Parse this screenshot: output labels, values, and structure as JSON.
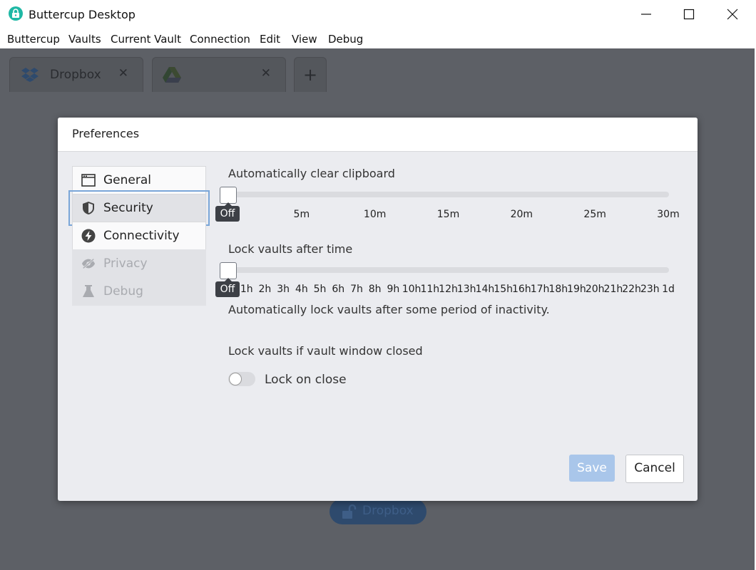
{
  "window": {
    "title": "Buttercup Desktop"
  },
  "menu": [
    "Buttercup",
    "Vaults",
    "Current Vault",
    "Connection",
    "Edit",
    "View",
    "Debug"
  ],
  "tabs": [
    {
      "label": "Dropbox",
      "icon": "dropbox-icon"
    },
    {
      "label": "",
      "icon": "google-drive-icon"
    }
  ],
  "background_button": {
    "label": "Dropbox"
  },
  "dialog": {
    "title": "Preferences",
    "nav": [
      {
        "label": "General",
        "icon": "window-icon",
        "state": "enabled"
      },
      {
        "label": "Security",
        "icon": "shield-icon",
        "state": "active"
      },
      {
        "label": "Connectivity",
        "icon": "bolt-icon",
        "state": "enabled"
      },
      {
        "label": "Privacy",
        "icon": "eye-slash-icon",
        "state": "disabled"
      },
      {
        "label": "Debug",
        "icon": "flask-icon",
        "state": "disabled"
      }
    ],
    "clipboard": {
      "label": "Automatically clear clipboard",
      "value": "Off",
      "ticks": [
        "Off",
        "5m",
        "10m",
        "15m",
        "20m",
        "25m",
        "30m"
      ]
    },
    "lock_time": {
      "label": "Lock vaults after time",
      "value": "Off",
      "ticks": [
        "Off",
        "1h",
        "2h",
        "3h",
        "4h",
        "5h",
        "6h",
        "7h",
        "8h",
        "9h",
        "10h",
        "11h",
        "12h",
        "13h",
        "14h",
        "15h",
        "16h",
        "17h",
        "18h",
        "19h",
        "20h",
        "21h",
        "22h",
        "23h",
        "1d"
      ],
      "description": "Automatically lock vaults after some period of inactivity."
    },
    "lock_close": {
      "label": "Lock vaults if vault window closed",
      "toggle_label": "Lock on close",
      "enabled": false
    },
    "buttons": {
      "save": "Save",
      "cancel": "Cancel"
    }
  }
}
